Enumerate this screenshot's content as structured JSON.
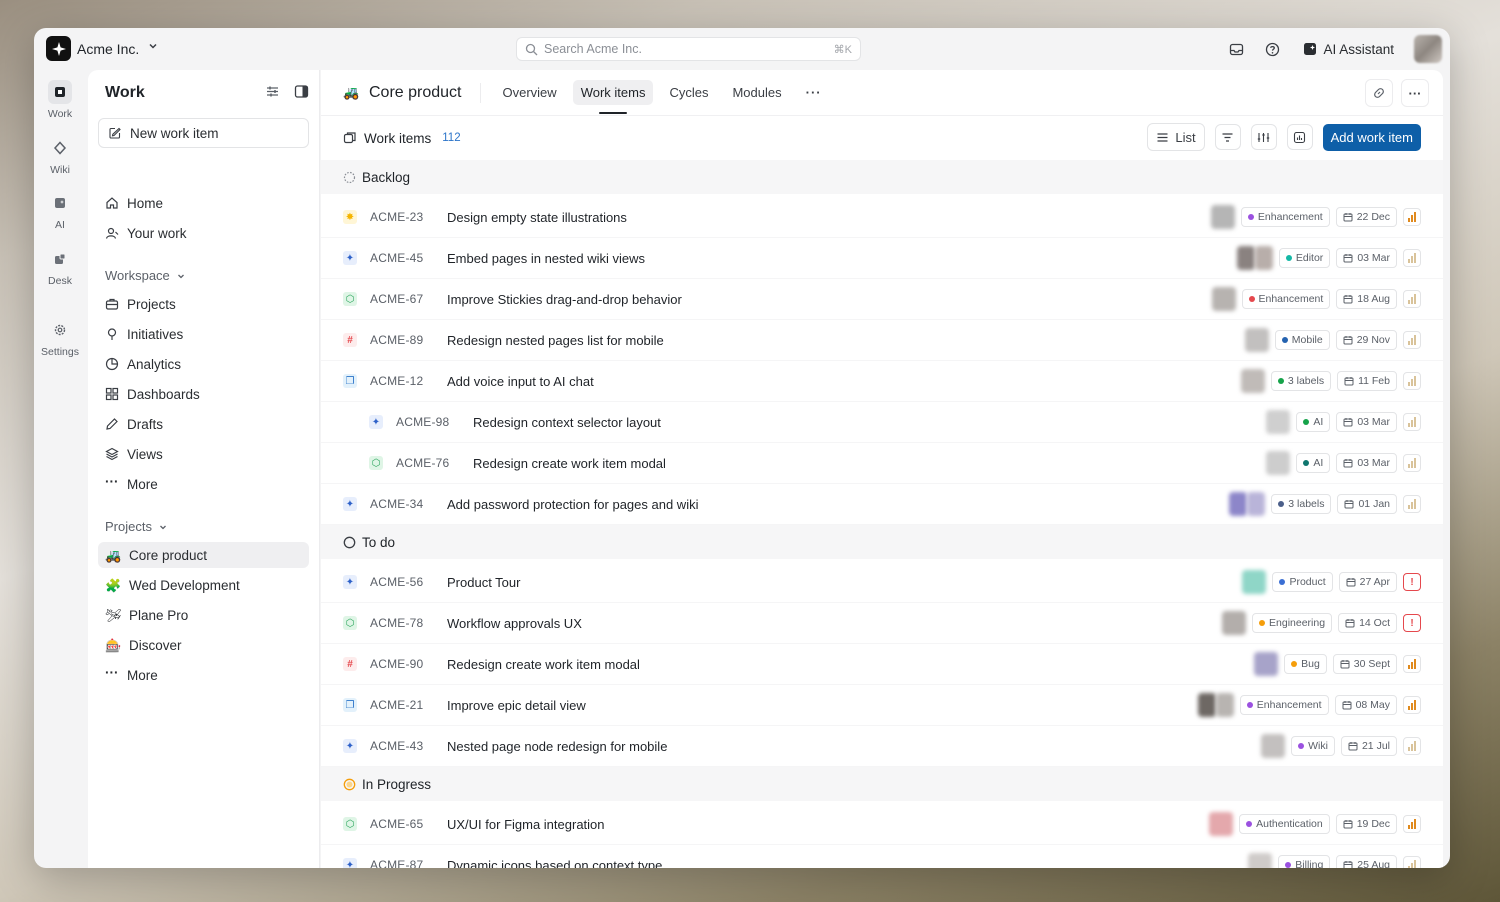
{
  "colors": {
    "accent": "#0e5fa8",
    "count": "#2b74c9"
  },
  "workspace": {
    "name": "Acme Inc."
  },
  "search": {
    "placeholder": "Search Acme Inc.",
    "shortcut": "⌘K"
  },
  "top_right": {
    "ai_label": "AI Assistant"
  },
  "rail": [
    {
      "label": "Work",
      "icon": "work-icon"
    },
    {
      "label": "Wiki",
      "icon": "wiki-icon"
    },
    {
      "label": "AI",
      "icon": "ai-icon"
    },
    {
      "label": "Desk",
      "icon": "desk-icon"
    },
    {
      "label": "Settings",
      "icon": "gear-icon"
    }
  ],
  "sidebar": {
    "title": "Work",
    "new_item_label": "New work item",
    "nav": [
      "Home",
      "Your work"
    ],
    "workspace_label": "Workspace",
    "workspace_items": [
      "Projects",
      "Initiatives",
      "Analytics",
      "Dashboards",
      "Drafts",
      "Views",
      "More"
    ],
    "projects_label": "Projects",
    "projects": [
      {
        "name": "Core product",
        "emoji": "🚜"
      },
      {
        "name": "Wed Development",
        "emoji": "🧩"
      },
      {
        "name": "Plane Pro",
        "emoji": "🛩"
      },
      {
        "name": "Discover",
        "emoji": "🎰"
      }
    ],
    "projects_more": "More"
  },
  "main": {
    "project_title": "Core product",
    "project_emoji": "🚜",
    "tabs": [
      "Overview",
      "Work items",
      "Cycles",
      "Modules"
    ],
    "sub_title": "Work items",
    "count": "112",
    "list_label": "List",
    "add_label": "Add work item"
  },
  "groups": [
    {
      "name": "Backlog",
      "items": [
        {
          "id": "ACME-23",
          "title": "Design empty state illustrations",
          "type": "star",
          "label": "Enhancement",
          "label_color": "#9b51e0",
          "date": "22 Dec",
          "priority": "high",
          "sub": false,
          "assignee": [
            "#b5b5b5"
          ]
        },
        {
          "id": "ACME-45",
          "title": "Embed pages in nested wiki views",
          "type": "spark",
          "label": "Editor",
          "label_color": "#14b8a6",
          "date": "03 Mar",
          "priority": "low",
          "sub": false,
          "assignee": [
            "#8a8280",
            "#b8aeaa"
          ]
        },
        {
          "id": "ACME-67",
          "title": "Improve Stickies drag-and-drop behavior",
          "type": "cube",
          "label": "Enhancement",
          "label_color": "#e5484d",
          "date": "18 Aug",
          "priority": "low",
          "sub": false,
          "assignee": [
            "#b7b3b0"
          ]
        },
        {
          "id": "ACME-89",
          "title": "Redesign nested pages list for mobile",
          "type": "hash",
          "label": "Mobile",
          "label_color": "#2563b0",
          "date": "29 Nov",
          "priority": "low",
          "sub": false,
          "assignee": [
            "#c2c0bf"
          ]
        },
        {
          "id": "ACME-12",
          "title": "Add voice input to AI chat",
          "type": "layers",
          "label": "3 labels",
          "label_color": "#16a34a",
          "date": "11 Feb",
          "priority": "low",
          "sub": false,
          "assignee": [
            "#c0bbb8"
          ]
        },
        {
          "id": "ACME-98",
          "title": "Redesign context selector layout",
          "type": "spark",
          "label": "AI",
          "label_color": "#16a34a",
          "date": "03 Mar",
          "priority": "low",
          "sub": true,
          "assignee": [
            "#cfcfcf"
          ]
        },
        {
          "id": "ACME-76",
          "title": "Redesign create work item modal",
          "type": "cube",
          "label": "AI",
          "label_color": "#0f766e",
          "date": "03 Mar",
          "priority": "low",
          "sub": true,
          "assignee": [
            "#cdcdcd"
          ]
        },
        {
          "id": "ACME-34",
          "title": "Add password protection for pages and wiki",
          "type": "spark",
          "label": "3 labels",
          "label_color": "#4b5f8a",
          "date": "01 Jan",
          "priority": "low",
          "sub": false,
          "assignee": [
            "#8d86c9",
            "#b9b4d9"
          ]
        }
      ]
    },
    {
      "name": "To do",
      "items": [
        {
          "id": "ACME-56",
          "title": "Product Tour",
          "type": "spark",
          "label": "Product",
          "label_color": "#3b6fd4",
          "date": "27 Apr",
          "priority": "urgent",
          "sub": false,
          "assignee": [
            "#8fd6c7"
          ]
        },
        {
          "id": "ACME-78",
          "title": "Workflow approvals UX",
          "type": "cube",
          "label": "Engineering",
          "label_color": "#f59e0b",
          "date": "14 Oct",
          "priority": "urgent",
          "sub": false,
          "assignee": [
            "#b3aeab"
          ]
        },
        {
          "id": "ACME-90",
          "title": "Redesign create work item modal",
          "type": "hash",
          "label": "Bug",
          "label_color": "#f59e0b",
          "date": "30 Sept",
          "priority": "high",
          "sub": false,
          "assignee": [
            "#a7a3c9"
          ]
        },
        {
          "id": "ACME-21",
          "title": "Improve epic detail view",
          "type": "layers",
          "label": "Enhancement",
          "label_color": "#9b51e0",
          "date": "08 May",
          "priority": "high",
          "sub": false,
          "assignee": [
            "#6e6864",
            "#b8b4b1"
          ]
        },
        {
          "id": "ACME-43",
          "title": "Nested page node redesign for mobile",
          "type": "spark",
          "label": "Wiki",
          "label_color": "#9b51e0",
          "date": "21 Jul",
          "priority": "low",
          "sub": false,
          "assignee": [
            "#c3c0bf"
          ]
        }
      ]
    },
    {
      "name": "In Progress",
      "items": [
        {
          "id": "ACME-65",
          "title": "UX/UI for Figma integration",
          "type": "cube",
          "label": "Authentication",
          "label_color": "#9b51e0",
          "date": "19 Dec",
          "priority": "high",
          "sub": false,
          "assignee": [
            "#e4a8ac"
          ]
        },
        {
          "id": "ACME-87",
          "title": "Dynamic icons based on context type",
          "type": "spark",
          "label": "Billing",
          "label_color": "#9b51e0",
          "date": "25 Aug",
          "priority": "low",
          "sub": false,
          "assignee": [
            "#cfcbc9"
          ]
        }
      ]
    }
  ]
}
